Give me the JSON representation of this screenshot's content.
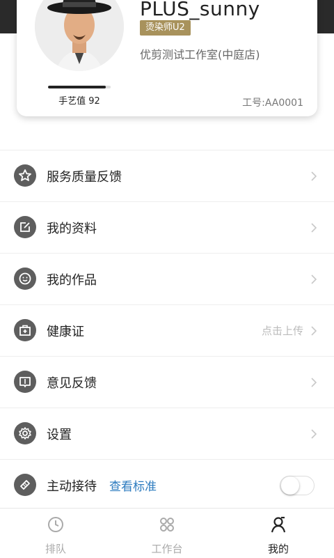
{
  "profile": {
    "username": "PLUS_sunny",
    "role_badge": "烫染师U2",
    "store_name": "优剪测试工作室(中庭店)",
    "skill_label": "手艺值 92",
    "skill_progress": 0.92,
    "staff_id": "工号:AA0001"
  },
  "menu": {
    "items": [
      {
        "label": "服务质量反馈",
        "icon": "star-icon"
      },
      {
        "label": "我的资料",
        "icon": "edit-icon"
      },
      {
        "label": "我的作品",
        "icon": "smile-icon"
      },
      {
        "label": "健康证",
        "icon": "medical-kit-icon",
        "hint": "点击上传"
      },
      {
        "label": "意见反馈",
        "icon": "book-icon"
      },
      {
        "label": "设置",
        "icon": "gear-icon"
      },
      {
        "label": "主动接待",
        "icon": "scissors-comb-icon",
        "link": "查看标准",
        "toggle_on": false
      }
    ]
  },
  "tabbar": {
    "tabs": [
      {
        "label": "排队",
        "icon": "clock-icon",
        "active": false
      },
      {
        "label": "工作台",
        "icon": "grid-icon",
        "active": false
      },
      {
        "label": "我的",
        "icon": "person-icon",
        "active": true
      }
    ]
  },
  "colors": {
    "badge": "#a8925c",
    "icon_bg": "#5e5e5e",
    "link": "#2c7bbf",
    "hint": "#bbbbbb"
  }
}
